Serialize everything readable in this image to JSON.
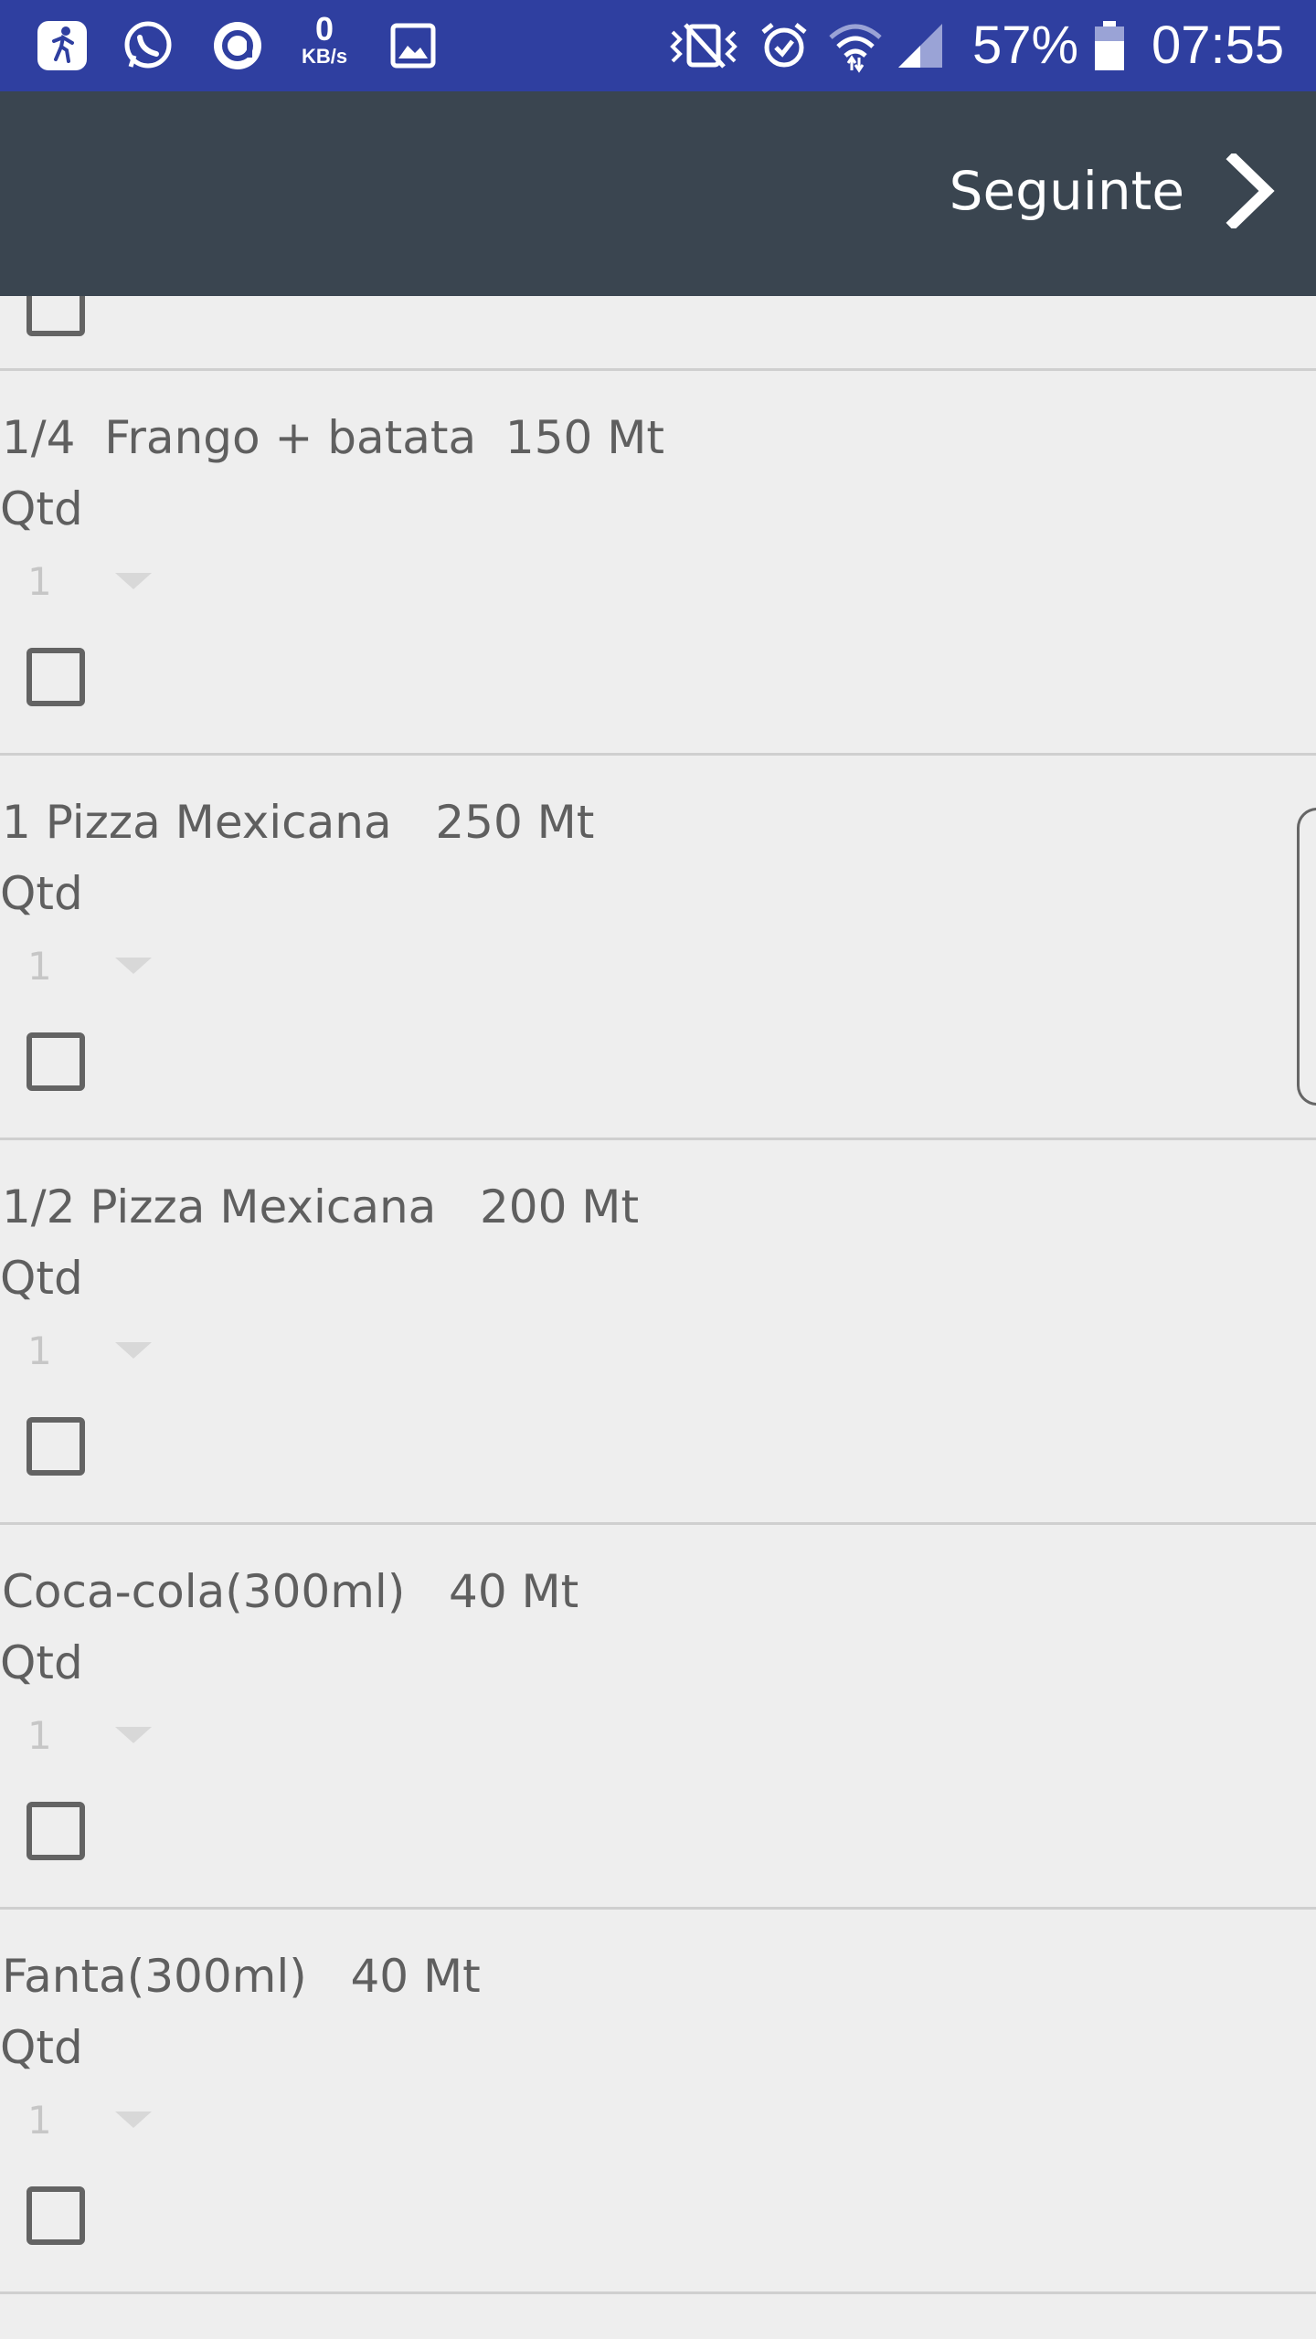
{
  "status_bar": {
    "network_speed_value": "0",
    "network_speed_unit": "KB/s",
    "battery_percent": "57%",
    "time": "07:55",
    "icons": [
      "activity-icon",
      "whatsapp-icon",
      "at-sign-icon",
      "image-icon",
      "vibrate-mute-icon",
      "alarm-icon",
      "wifi-icon",
      "signal-icon",
      "battery-icon"
    ]
  },
  "app_bar": {
    "next_label": "Seguinte",
    "next_icon": "chevron-right-icon"
  },
  "items": [
    {
      "title": "1/4  Frango + batata  150 Mt",
      "qty_label": "Qtd",
      "qty_value": "1"
    },
    {
      "title": "1 Pizza Mexicana   250 Mt",
      "qty_label": "Qtd",
      "qty_value": "1"
    },
    {
      "title": "1/2 Pizza Mexicana   200 Mt",
      "qty_label": "Qtd",
      "qty_value": "1"
    },
    {
      "title": "Coca-cola(300ml)   40 Mt",
      "qty_label": "Qtd",
      "qty_value": "1"
    },
    {
      "title": "Fanta(300ml)   40 Mt",
      "qty_label": "Qtd",
      "qty_value": "1"
    }
  ]
}
